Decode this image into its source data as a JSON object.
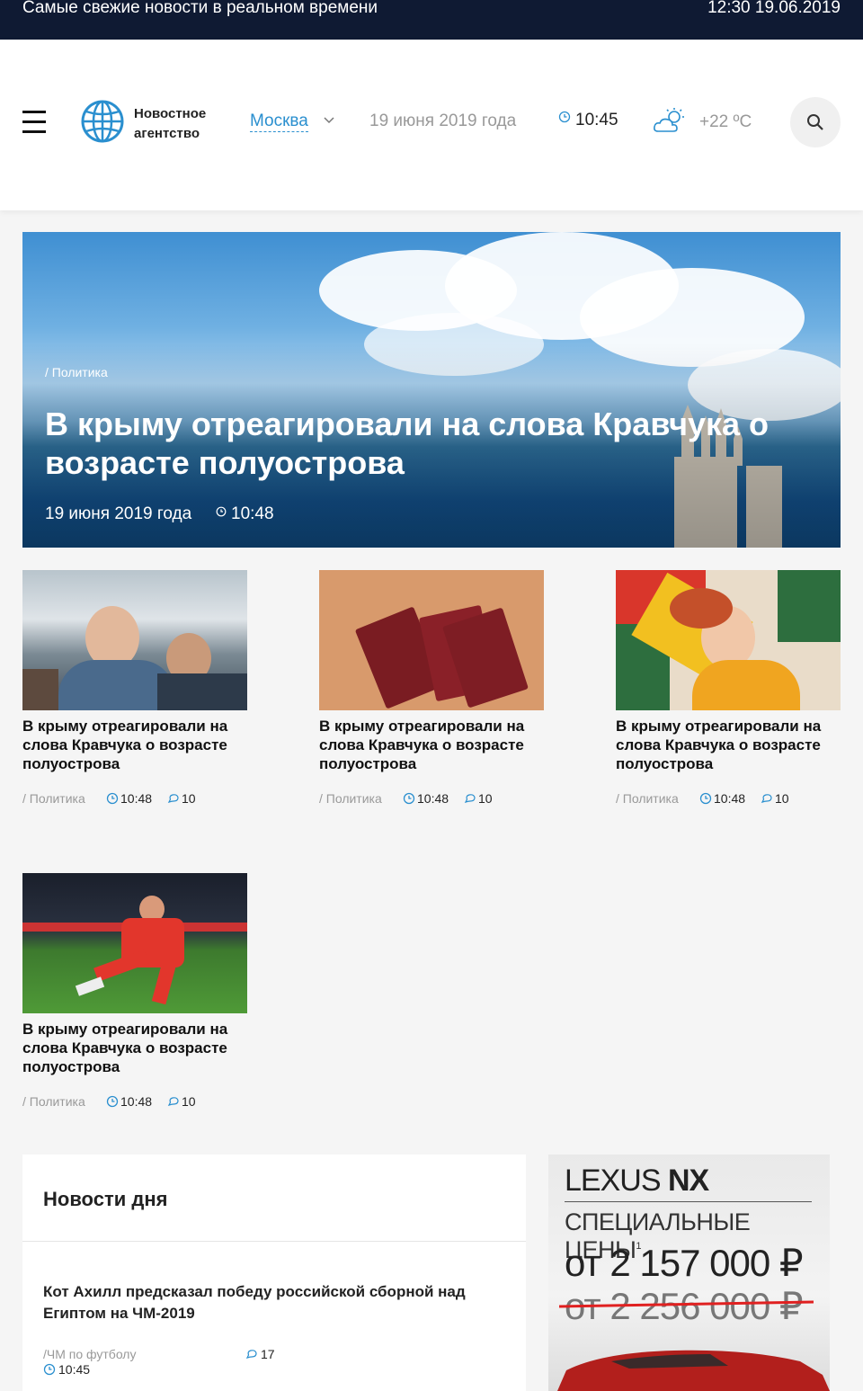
{
  "ticker": {
    "message": "Самые свежие новости в реальном времени",
    "datetime": "12:30 19.06.2019"
  },
  "header": {
    "logo_text": "Новостное агентство",
    "city": "Москва",
    "date": "19 июня 2019 года",
    "time": "10:45",
    "temperature": "+22 ºC"
  },
  "hero": {
    "category": "/ Политика",
    "title": "В крыму отреагировали на слова Кравчука о возрасте полуострова",
    "date": "19 июня 2019 года",
    "time": "10:48"
  },
  "cards": [
    {
      "title": "В крыму отреагировали на слова Кравчука о возрасте полуострова",
      "category": "/ Политика",
      "time": "10:48",
      "comments": "10"
    },
    {
      "title": "В крыму отреагировали на слова Кравчука о возрасте полуострова",
      "category": "/ Политика",
      "time": "10:48",
      "comments": "10"
    },
    {
      "title": "В крыму отреагировали на слова Кравчука о возрасте полуострова",
      "category": "/ Политика",
      "time": "10:48",
      "comments": "10"
    },
    {
      "title": "В крыму отреагировали на слова Кравчука о возрасте полуострова",
      "category": "/ Политика",
      "time": "10:48",
      "comments": "10"
    }
  ],
  "news_of_day": {
    "heading": "Новости дня",
    "item": {
      "title": "Кот Ахилл предсказал победу российской сборной над Египтом на ЧМ-2019",
      "category": "/ЧМ по футболу",
      "comments": "17",
      "time": "10:45"
    }
  },
  "ad": {
    "brand_light": "LEXUS",
    "brand_bold": "NX",
    "special": "СПЕЦИАЛЬНЫЕ ЦЕНЫ",
    "footnote": "1",
    "price": "от 2 157 000 ₽",
    "old_price": "от 2 256 000 ₽"
  },
  "colors": {
    "ticker_bg": "#0f1a33",
    "accent": "#2a8fcf",
    "page_bg": "#f5f5f5"
  }
}
